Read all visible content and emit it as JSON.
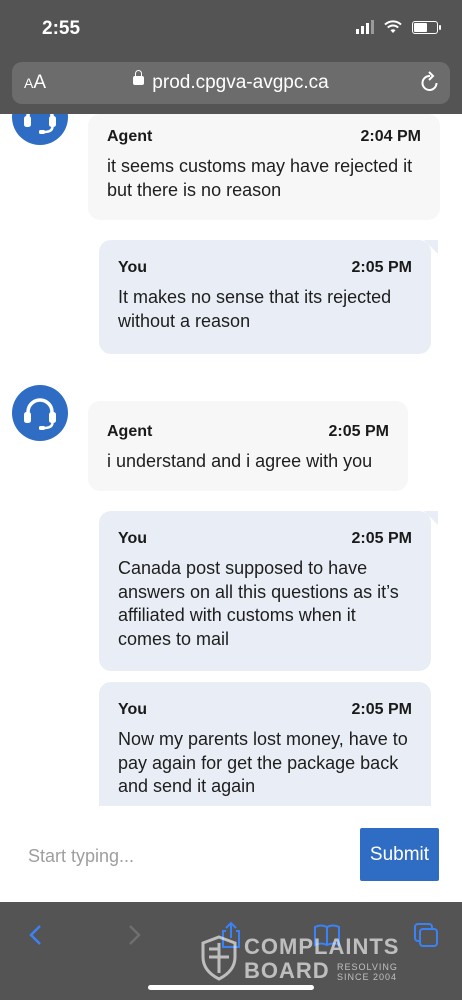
{
  "status_bar": {
    "time": "2:55"
  },
  "browser": {
    "text_size_small": "A",
    "text_size_large": "A",
    "url": "prod.cpgva-avgpc.ca"
  },
  "messages": [
    {
      "sender": "Agent",
      "time": "2:04 PM",
      "text": "it seems customs may have rejected it but there is no reason"
    },
    {
      "sender": "You",
      "time": "2:05 PM",
      "text": "It makes no sense that its rejected without a reason"
    },
    {
      "sender": "Agent",
      "time": "2:05 PM",
      "text": "i understand and i agree with you"
    },
    {
      "sender": "You",
      "time": "2:05 PM",
      "text": "Canada post supposed to have answers on all this questions as it’s affiliated with customs when it comes to mail"
    },
    {
      "sender": "You",
      "time": "2:05 PM",
      "text": "Now my parents lost money, have to pay again for get the package back and send it again"
    }
  ],
  "composer": {
    "placeholder": "Start typing...",
    "submit_label": "Submit"
  },
  "watermark": {
    "line1": "COMPLAINTS",
    "line2": "BOARD",
    "tagline1": "RESOLVING",
    "tagline2": "SINCE 2004"
  },
  "colors": {
    "accent": "#2f6cc4",
    "agent_bubble": "#f7f7f7",
    "you_bubble": "#e9eef6",
    "chrome": "#545454"
  },
  "icons": [
    "wifi-icon",
    "battery-icon",
    "lock-icon",
    "reload-icon",
    "headset-icon",
    "back-icon",
    "forward-icon",
    "share-icon",
    "bookmarks-icon",
    "tabs-icon"
  ]
}
